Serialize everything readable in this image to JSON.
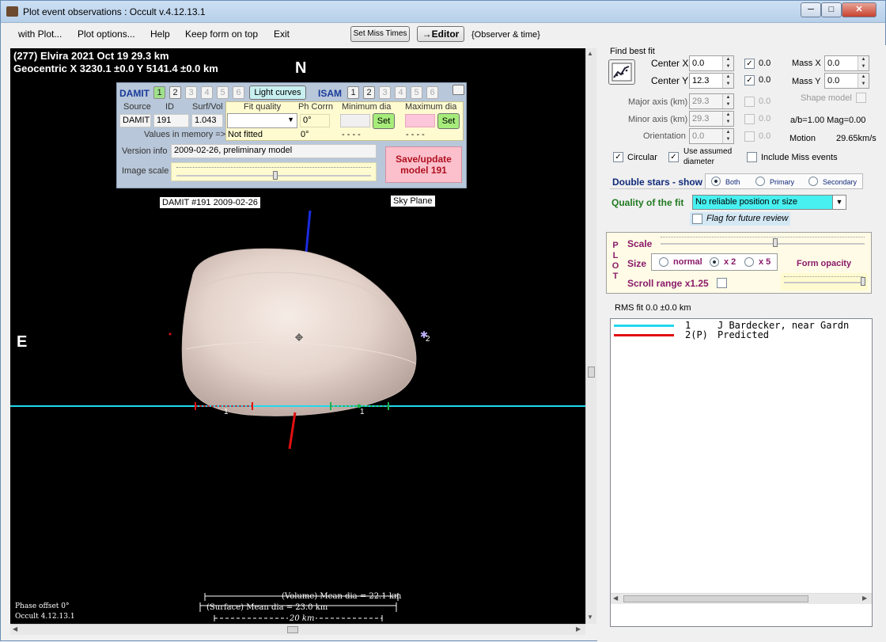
{
  "window": {
    "title": "Plot event observations : Occult v.4.12.13.1",
    "min": "─",
    "max": "□",
    "close": "✕"
  },
  "menu": {
    "items": [
      "with Plot...",
      "Plot options...",
      "Help",
      "Keep form on top",
      "Exit"
    ],
    "set_miss_times": "Set Miss Times",
    "editor": "→Editor",
    "observer_time": "{Observer & time}"
  },
  "plot": {
    "line1": "(277) Elvira  2021 Oct 19   29.3 km",
    "line2": "Geocentric  X  3230.1 ±0.0  Y 5141.4 ±0.0 km",
    "north": "N",
    "east": "E",
    "model_label": "DAMIT #191 2009-02-26",
    "sky_plane": "Sky Plane",
    "chord_label_1": "1",
    "chord_label_1b": "1",
    "star_label": "2",
    "volume_mean": "(Volume) Mean dia = 22.1 km",
    "surface_mean": "(Surface) Mean dia = 23.0 km",
    "scale_20km": "20 km",
    "phase_offset": "Phase offset 0°",
    "version": "Occult 4.12.13.1"
  },
  "damit": {
    "damit_label": "DAMIT",
    "damit_nums": [
      "1",
      "2",
      "3",
      "4",
      "5",
      "6"
    ],
    "light_curves": "Light curves",
    "isam_label": "ISAM",
    "isam_nums": [
      "1",
      "2",
      "3",
      "4",
      "5",
      "6"
    ],
    "headers": {
      "source": "Source",
      "id": "ID",
      "surf_vol": "Surf/Vol",
      "fit_quality": "Fit quality",
      "ph_corrn": "Ph Corrn",
      "min_dia": "Minimum dia",
      "max_dia": "Maximum dia"
    },
    "source": "DAMIT",
    "id": "191",
    "surf_vol": "1.043",
    "ph_corrn": "0°",
    "set1": "Set",
    "set2": "Set",
    "values_in_memory": "Values in memory =>",
    "not_fitted": "Not fitted",
    "ph_mem": "0°",
    "min_mem": "- - - -",
    "max_mem": "- - - -",
    "version_info_label": "Version info",
    "version_info": "2009-02-26, preliminary model",
    "image_scale_label": "Image scale",
    "save_line1": "Save/update",
    "save_line2": "model  191"
  },
  "fit": {
    "find_best_fit": "Find best fit",
    "center_x_label": "Center X",
    "center_x": "0.0",
    "center_x_chk": "0.0",
    "center_y_label": "Center Y",
    "center_y": "12.3",
    "center_y_chk": "0.0",
    "mass_x_label": "Mass X",
    "mass_x": "0.0",
    "mass_y_label": "Mass Y",
    "mass_y": "0.0",
    "major_label": "Major axis (km)",
    "major": "29.3",
    "major_chk": "0.0",
    "minor_label": "Minor axis (km)",
    "minor": "29.3",
    "minor_chk": "0.0",
    "orient_label": "Orientation",
    "orient": "0.0",
    "orient_chk": "0.0",
    "shape_model": "Shape model",
    "ab_mag": "a/b=1.00  Mag=0.00",
    "motion_label": "Motion",
    "motion": "29.65km/s",
    "circular": "Circular",
    "use_assumed_1": "Use assumed",
    "use_assumed_2": "diameter",
    "include_miss": "Include Miss events",
    "double_stars": "Double stars - show",
    "ds_both": "Both",
    "ds_primary": "Primary",
    "ds_secondary": "Secondary",
    "quality_label": "Quality of the fit",
    "quality_value": "No reliable position or size",
    "flag_review": "Flag for future review"
  },
  "plotpanel": {
    "side": [
      "P",
      "L",
      "O",
      "T"
    ],
    "scale": "Scale",
    "size": "Size",
    "normal": "normal",
    "x2": "x 2",
    "x5": "x 5",
    "form_opacity": "Form opacity",
    "scroll_range": "Scroll range x1.25"
  },
  "rms": "RMS fit 0.0 ±0.0 km",
  "legend": [
    {
      "num": "1",
      "name": "J Bardecker, near Gardn",
      "color": "#22d8ee"
    },
    {
      "num": "2(P)",
      "name": "Predicted",
      "color": "#e01010"
    }
  ]
}
